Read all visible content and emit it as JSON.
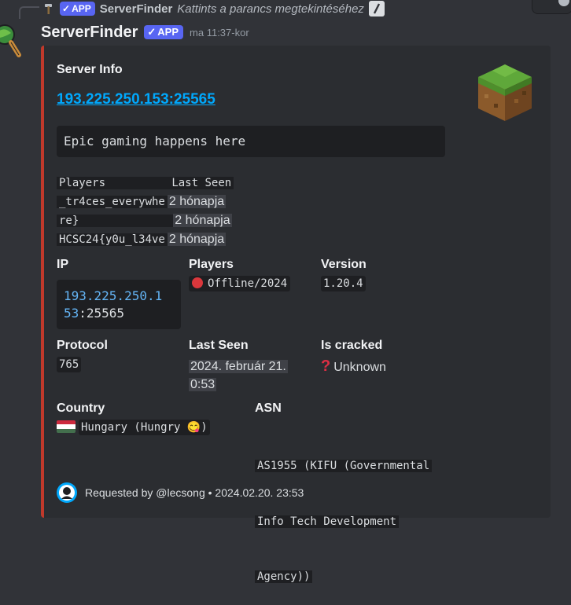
{
  "reply": {
    "author": "ServerFinder",
    "badge": "APP",
    "text": "Kattints a parancs megtekintéséhez"
  },
  "message": {
    "author": "ServerFinder",
    "badge": "APP",
    "timestamp": "ma 11:37-kor"
  },
  "embed": {
    "accent_color": "#c0392b",
    "title": "Server Info",
    "link_text": "193.225.250.153:25565",
    "description": "Epic gaming happens here",
    "players_table": {
      "header_player": "Players",
      "header_seen": "Last Seen",
      "rows": [
        {
          "name": "_tr4ces_everywhe",
          "seen": "2 hónapja"
        },
        {
          "name": "re}",
          "seen": "2 hónapja"
        },
        {
          "name": "HCSC24{y0u_l34ve",
          "seen": "2 hónapja"
        }
      ]
    },
    "fields": {
      "ip": {
        "name": "IP",
        "line1": "193.225.250.1",
        "line2_num": "53",
        "line2_rest": ":25565"
      },
      "players": {
        "name": "Players",
        "value": "Offline/2024"
      },
      "version": {
        "name": "Version",
        "value": "1.20.4"
      },
      "protocol": {
        "name": "Protocol",
        "value": "765"
      },
      "last_seen": {
        "name": "Last Seen",
        "line1": "2024. február 21.",
        "line2": "0:53"
      },
      "cracked": {
        "name": "Is cracked",
        "value": "Unknown"
      },
      "country": {
        "name": "Country",
        "value": "Hungary (Hungry 😋)"
      },
      "asn": {
        "name": "ASN",
        "line1": "AS1955 (KIFU (Governmental",
        "line2": "Info Tech Development",
        "line3": "Agency))"
      }
    },
    "footer": {
      "text": "Requested by @lecsong • 2024.02.20. 23:53"
    }
  },
  "icons": {
    "reply_icon": "hammer-icon",
    "command_icon": "slash-command-icon",
    "avatar": "magnifier-globe-icon",
    "thumbnail": "minecraft-grass-block-icon",
    "status_icon": "red-circle-icon",
    "cracked_icon": "question-mark-icon",
    "country_flag": "hungary-flag-icon",
    "footer_avatar": "user-avatar-icon"
  }
}
